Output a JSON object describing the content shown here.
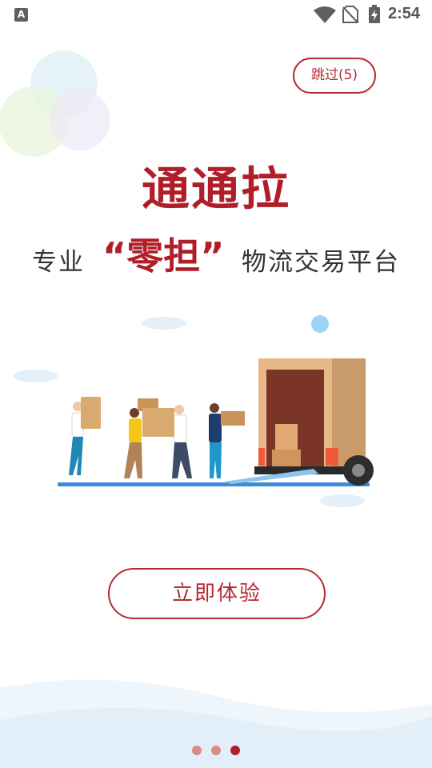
{
  "status_bar": {
    "time": "2:54",
    "notification_icon": "A"
  },
  "skip_button": {
    "label": "跳过(5)"
  },
  "brand": {
    "logo_text": "通通拉"
  },
  "tagline": {
    "prefix": "专业",
    "highlight": "“零担”",
    "suffix": "物流交易平台"
  },
  "cta": {
    "label": "立即体验"
  },
  "pager": {
    "count": 3,
    "active_index": 2
  },
  "colors": {
    "brand_red": "#b01f29",
    "text_dark": "#333333",
    "cloud_blue": "#dcebf6"
  },
  "icons": [
    "wifi-icon",
    "no-sim-icon",
    "battery-charging-icon",
    "notification-a-icon"
  ]
}
